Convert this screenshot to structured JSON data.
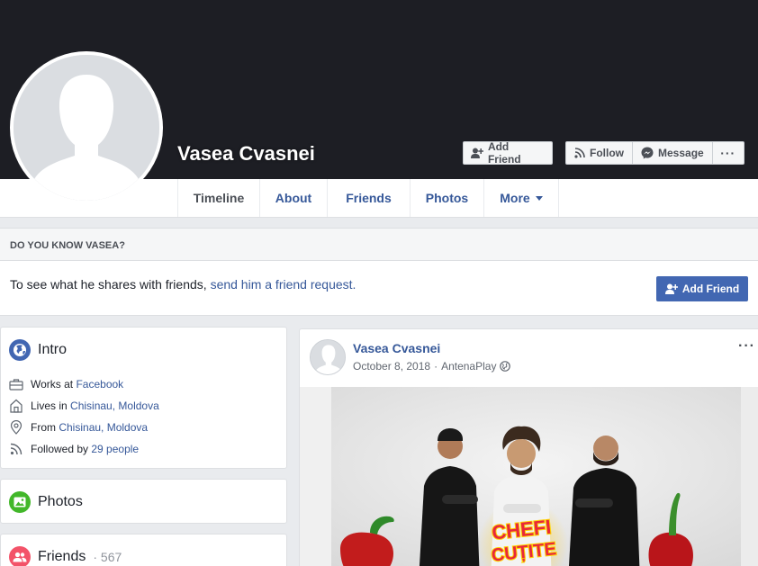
{
  "profile": {
    "name": "Vasea Cvasnei",
    "add_friend_label": "Add Friend",
    "follow_label": "Follow",
    "message_label": "Message",
    "more_dots": "···"
  },
  "tabs": [
    {
      "label": "Timeline",
      "active": true
    },
    {
      "label": "About"
    },
    {
      "label": "Friends"
    },
    {
      "label": "Photos"
    },
    {
      "label": "More"
    }
  ],
  "know": {
    "heading": "DO YOU KNOW VASEA?",
    "text_prefix": "To see what he shares with friends, ",
    "link": "send him a friend request.",
    "button_label": "Add Friend"
  },
  "intro": {
    "title": "Intro",
    "rows": [
      {
        "icon": "briefcase-icon",
        "prefix": "Works at ",
        "link": "Facebook"
      },
      {
        "icon": "home-icon",
        "prefix": "Lives in ",
        "link": "Chisinau, Moldova"
      },
      {
        "icon": "location-pin-icon",
        "prefix": "From ",
        "link": "Chisinau, Moldova"
      },
      {
        "icon": "rss-icon",
        "prefix": "Followed by ",
        "link": "29 people"
      }
    ]
  },
  "photos": {
    "title": "Photos"
  },
  "friends": {
    "title": "Friends",
    "count": " · 567"
  },
  "post": {
    "author": "Vasea Cvasnei",
    "date": "October 8, 2018",
    "separator": "·",
    "source": "AntenaPlay",
    "menu": "···",
    "image_logo_text_1": "CHEFI",
    "image_logo_text_2": "CUȚITE"
  },
  "colors": {
    "fb_blue": "#4267b2",
    "link_blue": "#365899",
    "cover_dark": "#1d1e24",
    "intro_icon": "#4267b2",
    "photos_icon": "#42b72a",
    "friends_icon": "#f35369"
  }
}
